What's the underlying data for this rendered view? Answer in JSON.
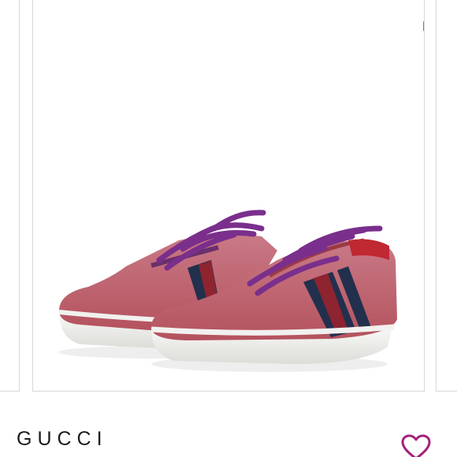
{
  "listing": {
    "brand": "GUCCI"
  },
  "icons": {
    "expand": "expand-arrows-icon",
    "like": "heart-outline-icon"
  },
  "colors": {
    "accent": "#a3227a",
    "shoe_body": "#c9646e",
    "laces": "#7a2f8c",
    "stripe_navy": "#1f2a4a",
    "stripe_red": "#8c1f2c"
  }
}
